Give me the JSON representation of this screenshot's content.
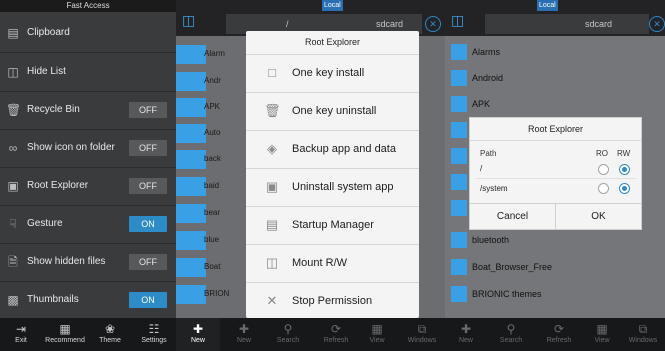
{
  "fast_access": {
    "title": "Fast Access",
    "items": [
      {
        "label": "Clipboard",
        "icon": "clipboard-icon",
        "toggle": ""
      },
      {
        "label": "Hide List",
        "icon": "hide-list-icon",
        "toggle": ""
      },
      {
        "label": "Recycle Bin",
        "icon": "trash-icon",
        "toggle": "OFF"
      },
      {
        "label": "Show icon on folder",
        "icon": "link-icon",
        "toggle": "OFF"
      },
      {
        "label": "Root Explorer",
        "icon": "root-icon",
        "toggle": "OFF"
      },
      {
        "label": "Gesture",
        "icon": "gesture-icon",
        "toggle": "ON"
      },
      {
        "label": "Show hidden files",
        "icon": "hidden-file-icon",
        "toggle": "OFF"
      },
      {
        "label": "Thumbnails",
        "icon": "image-icon",
        "toggle": "ON"
      }
    ],
    "bottom": [
      "Exit",
      "Recommend",
      "Theme",
      "Settings"
    ]
  },
  "panel2": {
    "local_badge": "Local",
    "path": "/",
    "path2": "sdcard",
    "folders": [
      "Alarm",
      "Andr",
      "APK",
      "Auto",
      "back",
      "baid",
      "bear",
      "blue",
      "Boat",
      "BRION"
    ],
    "bottom": [
      "New",
      "New",
      "Search",
      "Refresh",
      "View",
      "Windows"
    ],
    "dialog": {
      "title": "Root Explorer",
      "items": [
        {
          "label": "One key install",
          "icon": "install-icon"
        },
        {
          "label": "One key uninstall",
          "icon": "uninstall-icon"
        },
        {
          "label": "Backup app and data",
          "icon": "android-icon"
        },
        {
          "label": "Uninstall system app",
          "icon": "system-app-icon"
        },
        {
          "label": "Startup Manager",
          "icon": "startup-icon"
        },
        {
          "label": "Mount R/W",
          "icon": "mount-icon"
        },
        {
          "label": "Stop Permission",
          "icon": "close-icon"
        }
      ]
    }
  },
  "panel3": {
    "local_badge": "Local",
    "path": "sdcard",
    "folders": [
      "Alarms",
      "Android",
      "APK",
      "",
      "",
      "",
      "",
      "bluetooth",
      "Boat_Browser_Free",
      "BRIONIC themes"
    ],
    "bottom": [
      "New",
      "Search",
      "Refresh",
      "View",
      "Windows"
    ],
    "dialog": {
      "title": "Root Explorer",
      "col_path": "Path",
      "col_ro": "RO",
      "col_rw": "RW",
      "rows": [
        {
          "path": "/",
          "selected": "RW"
        },
        {
          "path": "/system",
          "selected": "RW"
        }
      ],
      "cancel": "Cancel",
      "ok": "OK"
    }
  },
  "colors": {
    "accent": "#2d8bc8",
    "folder": "#3aa0e6",
    "dark": "#3a3b3d"
  }
}
